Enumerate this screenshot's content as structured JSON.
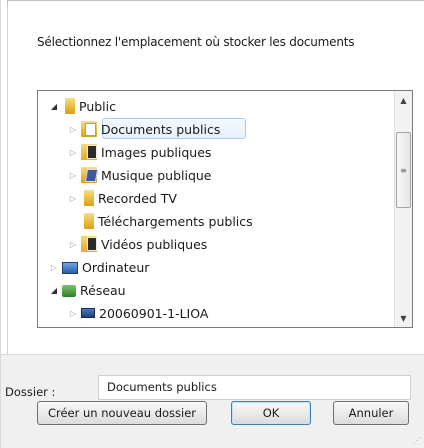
{
  "instruction": "Sélectionnez l'emplacement où stocker les documents",
  "tree": {
    "items": [
      {
        "label": "Public",
        "expander": "open",
        "icon": "folder-icon"
      },
      {
        "label": "Documents publics",
        "expander": "closed",
        "icon": "documents-folder-icon",
        "selected": true
      },
      {
        "label": "Images publiques",
        "expander": "closed",
        "icon": "pictures-folder-icon"
      },
      {
        "label": "Musique publique",
        "expander": "closed",
        "icon": "music-folder-icon"
      },
      {
        "label": "Recorded TV",
        "expander": "closed",
        "icon": "folder-icon"
      },
      {
        "label": "Téléchargements publics",
        "expander": "none",
        "icon": "folder-icon"
      },
      {
        "label": "Vidéos publiques",
        "expander": "closed",
        "icon": "videos-folder-icon"
      },
      {
        "label": "Ordinateur",
        "expander": "closed",
        "icon": "computer-icon"
      },
      {
        "label": "Réseau",
        "expander": "open",
        "icon": "network-icon"
      },
      {
        "label": "20060901-1-LIOA",
        "expander": "closed",
        "icon": "network-computer-icon"
      }
    ]
  },
  "folder_field": {
    "label": "Dossier :",
    "value": "Documents publics"
  },
  "buttons": {
    "new_folder": "Créer un nouveau dossier",
    "ok": "OK",
    "cancel": "Annuler"
  }
}
